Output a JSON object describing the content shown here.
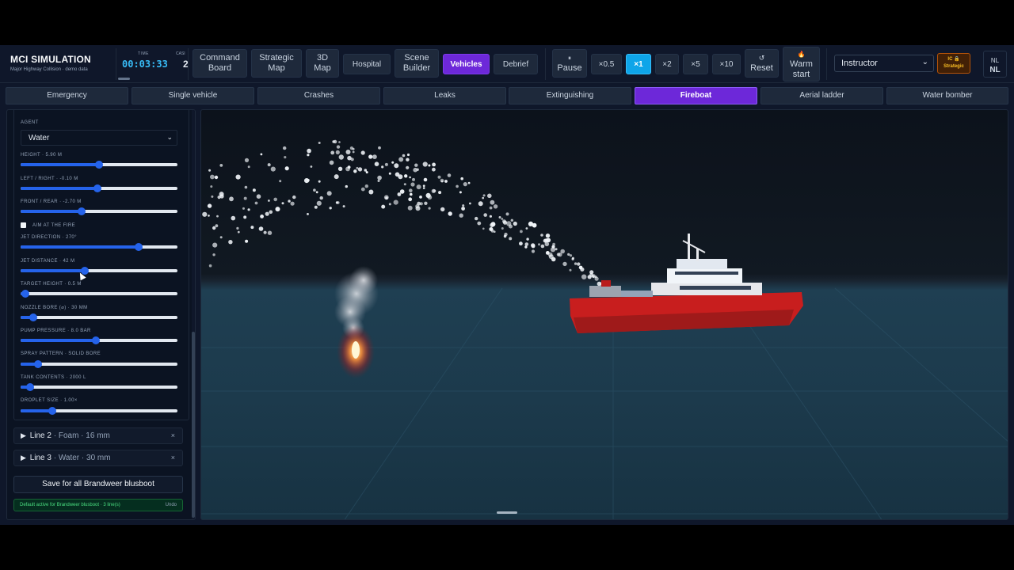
{
  "app": {
    "title": "MCI SIMULATION",
    "subtitle": "Major Highway Collision · demo data"
  },
  "clock": {
    "time_label": "TIME",
    "time_value": "00:03:33",
    "cas_label": "CASI",
    "cas_value": "2"
  },
  "nav": {
    "command_board": "Command Board",
    "strategic_map": "Strategic Map",
    "map_3d": "3D Map",
    "hospital": "Hospital",
    "scene_builder": "Scene Builder",
    "vehicles": "Vehicles",
    "debrief": "Debrief"
  },
  "playback": {
    "pause_icon": "⏸",
    "pause": "Pause",
    "speeds": [
      "×0.5",
      "×1",
      "×2",
      "×5",
      "×10"
    ],
    "active_speed": "×1",
    "reset_icon": "↺",
    "reset": "Reset",
    "warm_icon": "🔥",
    "warm_start": "Warm start"
  },
  "role": {
    "selected": "Instructor",
    "badge": "IC 🔒 Strategic"
  },
  "lang": {
    "top": "NL",
    "bottom": "NL"
  },
  "tabs": [
    "Emergency",
    "Single vehicle",
    "Crashes",
    "Leaks",
    "Extinguishing",
    "Fireboat",
    "Aerial ladder",
    "Water bomber"
  ],
  "active_tab": "Fireboat",
  "panel": {
    "agent_label": "AGENT",
    "agent_value": "Water",
    "height_label": "HEIGHT · 5.90 M",
    "height_value": 0.5,
    "left_right_label": "LEFT / RIGHT · -0.10 M",
    "left_right_value": 0.49,
    "front_rear_label": "FRONT / REAR · -2.70 M",
    "front_rear_value": 0.39,
    "aim_label": "AIM AT THE FIRE",
    "aim_checked": false,
    "jet_direction_label": "JET DIRECTION · 270°",
    "jet_direction_value": 0.75,
    "jet_distance_label": "JET DISTANCE · 42 M",
    "jet_distance_value": 0.41,
    "target_height_label": "TARGET HEIGHT · 0.5 M",
    "target_height_value": 0.03,
    "nozzle_bore_label": "NOZZLE BORE (⌀) · 30 MM",
    "nozzle_bore_value": 0.08,
    "pump_pressure_label": "PUMP PRESSURE · 8.0 BAR",
    "pump_pressure_value": 0.48,
    "spray_pattern_label": "SPRAY PATTERN · SOLID BORE",
    "spray_pattern_value": 0.11,
    "tank_contents_label": "TANK CONTENTS · 2000 L",
    "tank_contents_value": 0.06,
    "droplet_size_label": "DROPLET SIZE · 1.00×",
    "droplet_size_value": 0.2,
    "lines": [
      {
        "name": "Line 2",
        "meta": " · Foam · 16 mm"
      },
      {
        "name": "Line 3",
        "meta": " · Water · 30 mm"
      }
    ],
    "save_label": "Save for all Brandweer blusboot",
    "status_text": "Default active for Brandweer blusboot · 3 line(s)",
    "undo_label": "Undo"
  },
  "colors": {
    "accent_purple": "#6d28d9",
    "accent_blue": "#0ea5e9",
    "slider": "#2563eb",
    "fireboat_hull": "#c81e1e"
  }
}
